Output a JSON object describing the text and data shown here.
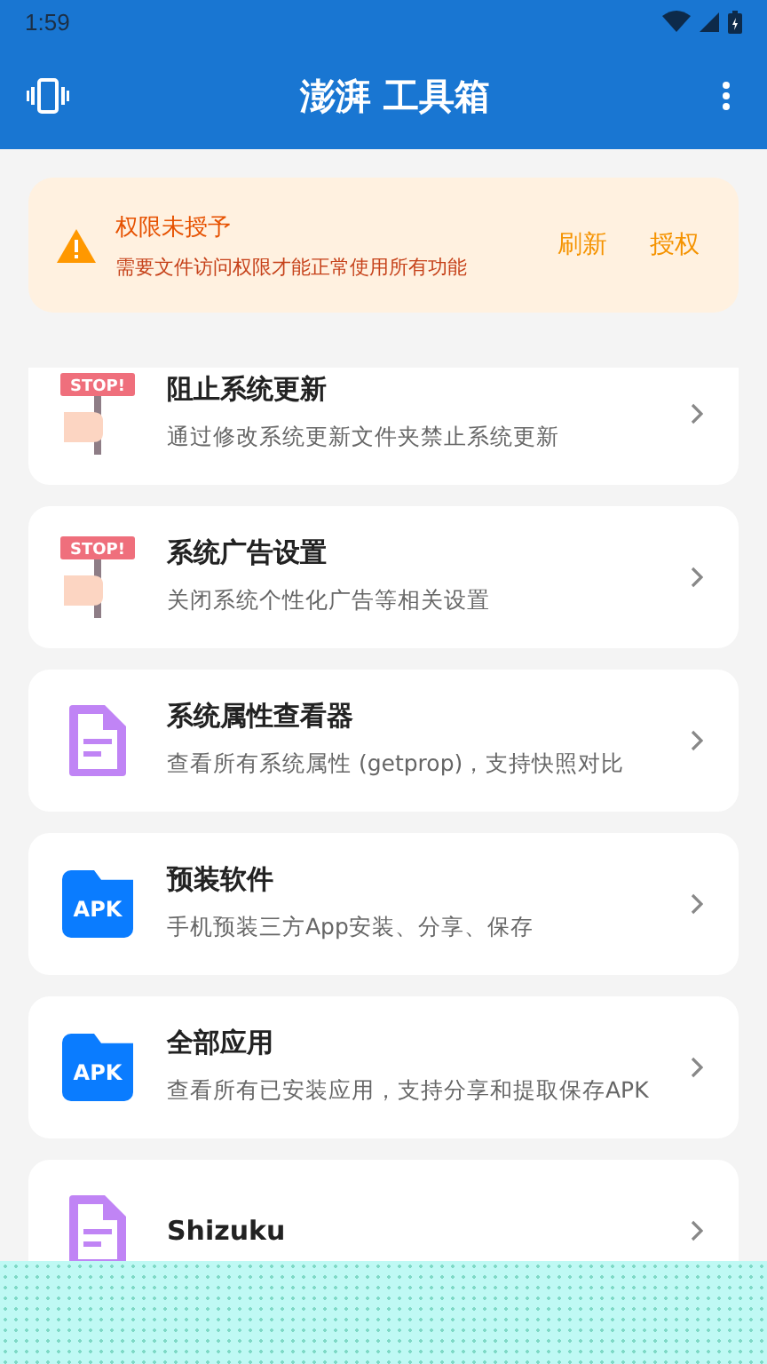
{
  "status_bar": {
    "time": "1:59"
  },
  "app_bar": {
    "title": "澎湃 工具箱"
  },
  "warning": {
    "title": "权限未授予",
    "message": "需要文件访问权限才能正常使用所有功能",
    "actions": [
      "刷新",
      "授权"
    ]
  },
  "tools": [
    {
      "kind": "stop",
      "sign_text": "STOP!",
      "title": "阻止系统更新",
      "subtitle": "通过修改系统更新文件夹禁止系统更新"
    },
    {
      "kind": "stop",
      "sign_text": "STOP!",
      "title": "系统广告设置",
      "subtitle": "关闭系统个性化广告等相关设置"
    },
    {
      "kind": "document",
      "title": "系统属性查看器",
      "subtitle": "查看所有系统属性 (getprop)，支持快照对比"
    },
    {
      "kind": "apk",
      "icon_label": "APK",
      "title": "预装软件",
      "subtitle": "手机预装三方App安装、分享、保存"
    },
    {
      "kind": "apk",
      "icon_label": "APK",
      "title": "全部应用",
      "subtitle": "查看所有已安装应用，支持分享和提取保存APK"
    },
    {
      "kind": "document",
      "title": "Shizuku"
    }
  ]
}
